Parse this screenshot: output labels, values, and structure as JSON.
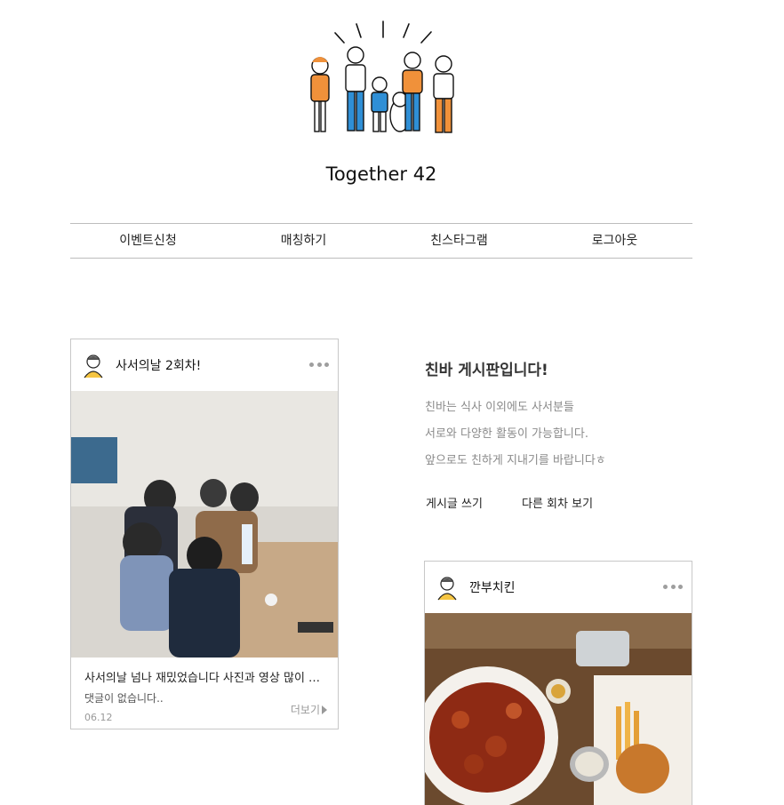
{
  "site": {
    "title": "Together 42"
  },
  "nav": {
    "items": [
      "이벤트신청",
      "매칭하기",
      "친스타그램",
      "로그아웃"
    ]
  },
  "post1": {
    "title": "사서의날 2회차!",
    "caption": "사서의날 넘나 재밌었습니다 사진과 영상 많이 남겼어요",
    "comments": "댓글이 없습니다..",
    "date": "06.12",
    "more_label": "더보기"
  },
  "board": {
    "title": "친바 게시판입니다!",
    "lines": [
      "친바는 식사 이외에도 사서분들",
      "서로와 다양한 활동이 가능합니다.",
      "앞으로도 친하게 지내기를 바랍니다ㅎ"
    ],
    "write_label": "게시글 쓰기",
    "other_label": "다른 회차 보기"
  },
  "post2": {
    "title": "깐부치킨"
  },
  "colors": {
    "accent_orange": "#f0913a",
    "accent_blue": "#2f8fd6",
    "muted_text": "#8a8a8a"
  }
}
